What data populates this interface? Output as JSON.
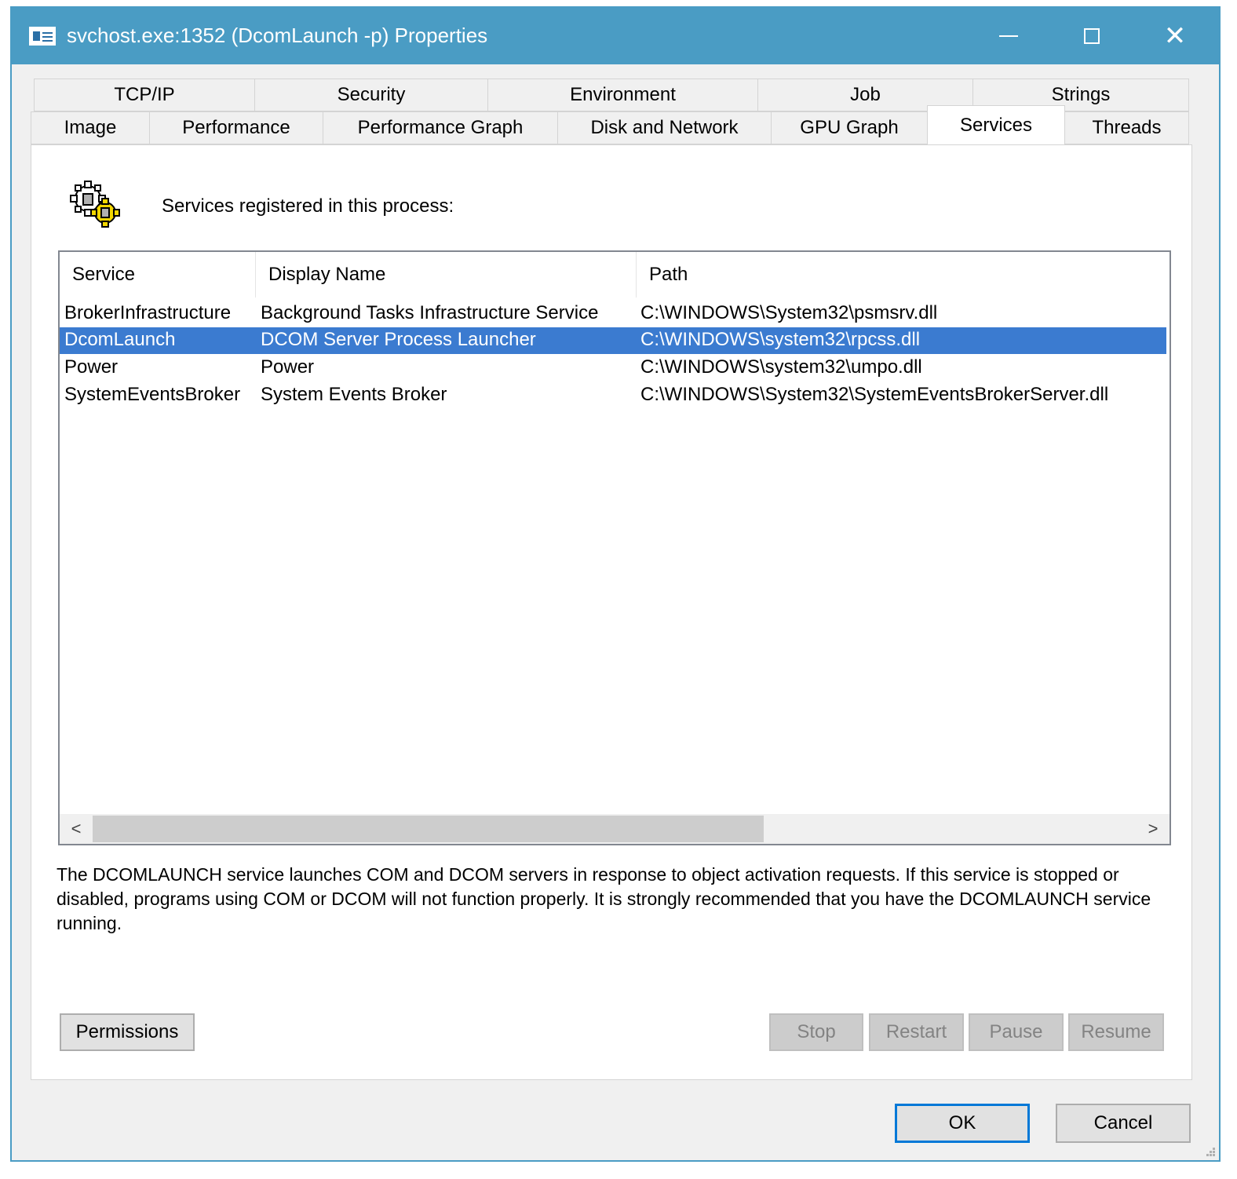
{
  "window": {
    "title": "svchost.exe:1352 (DcomLaunch -p) Properties",
    "controls": {
      "minimize": "—",
      "maximize": "☐",
      "close": "✕"
    }
  },
  "tabs": {
    "row_back": [
      "TCP/IP",
      "Security",
      "Environment",
      "Job",
      "Strings"
    ],
    "row_front": [
      "Image",
      "Performance",
      "Performance Graph",
      "Disk and Network",
      "GPU Graph",
      "Services",
      "Threads"
    ],
    "active": "Services"
  },
  "services_panel": {
    "label": "Services registered in this process:",
    "icon": "gears-icon",
    "columns": [
      "Service",
      "Display Name",
      "Path"
    ],
    "rows": [
      {
        "service": "BrokerInfrastructure",
        "display_name": "Background Tasks Infrastructure Service",
        "path": "C:\\WINDOWS\\System32\\psmsrv.dll",
        "selected": false
      },
      {
        "service": "DcomLaunch",
        "display_name": "DCOM Server Process Launcher",
        "path": "C:\\WINDOWS\\system32\\rpcss.dll",
        "selected": true
      },
      {
        "service": "Power",
        "display_name": "Power",
        "path": "C:\\WINDOWS\\system32\\umpo.dll",
        "selected": false
      },
      {
        "service": "SystemEventsBroker",
        "display_name": "System Events Broker",
        "path": "C:\\WINDOWS\\System32\\SystemEventsBrokerServer.dll",
        "selected": false
      }
    ],
    "scroll": {
      "left": "<",
      "right": ">"
    },
    "description": "The DCOMLAUNCH service launches COM and DCOM servers in response to object activation requests. If this service is stopped or disabled, programs using COM or DCOM will not function properly. It is strongly recommended that you have the DCOMLAUNCH service running.",
    "buttons": {
      "permissions": "Permissions",
      "stop": "Stop",
      "restart": "Restart",
      "pause": "Pause",
      "resume": "Resume"
    }
  },
  "dialog_buttons": {
    "ok": "OK",
    "cancel": "Cancel"
  },
  "colors": {
    "titlebar": "#4a9cc4",
    "selection": "#3b7bd0",
    "default_button_border": "#0078d7"
  }
}
